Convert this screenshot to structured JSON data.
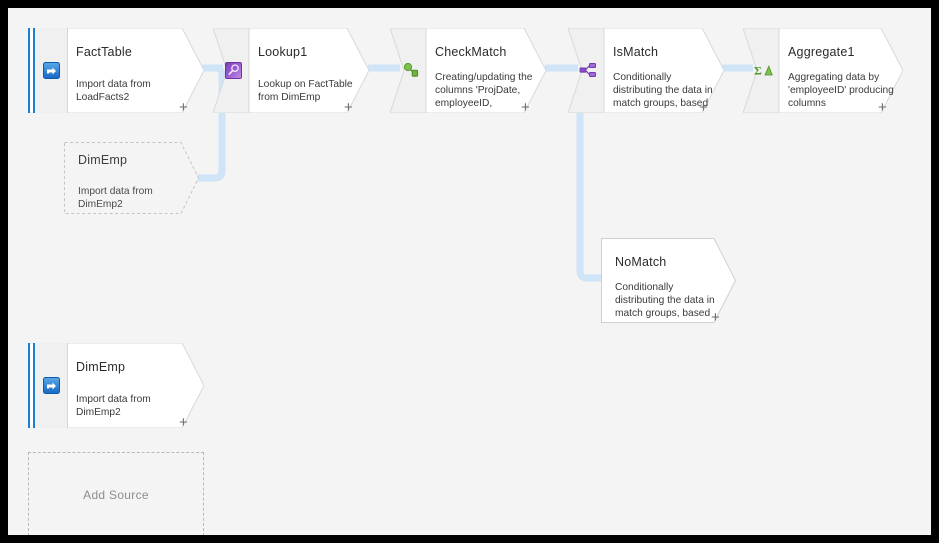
{
  "canvas": {
    "background_color": "#f4f4f4",
    "frame_color": "#000000",
    "connector_color": "#cfe5f7",
    "accent_color": "#1c7fd6"
  },
  "nodes": {
    "fact_table": {
      "title": "FactTable",
      "description": "Import data from LoadFacts2",
      "icon": "import-source-icon",
      "plus": "+",
      "kind": "source"
    },
    "lookup1": {
      "title": "Lookup1",
      "description": "Lookup on FactTable from DimEmp",
      "icon": "lookup-magnifier-icon",
      "plus": "+",
      "kind": "transform"
    },
    "check_match": {
      "title": "CheckMatch",
      "description": "Creating/updating the columns 'ProjDate, employeeID,",
      "icon": "derived-column-icon",
      "plus": "+",
      "kind": "transform"
    },
    "is_match": {
      "title": "IsMatch",
      "description": "Conditionally distributing the data in match groups, based",
      "icon": "conditional-split-icon",
      "plus": "+",
      "kind": "transform"
    },
    "aggregate1": {
      "title": "Aggregate1",
      "description": "Aggregating data by 'employeeID' producing columns",
      "icon": "aggregate-sigma-icon",
      "plus": "+",
      "kind": "transform"
    },
    "no_match": {
      "title": "NoMatch",
      "description": "Conditionally distributing the data in match groups, based",
      "icon": "none",
      "plus": "+",
      "kind": "branch"
    },
    "dim_emp_ghost": {
      "title": "DimEmp",
      "description": "Import data from DimEmp2",
      "icon": "none",
      "kind": "ghost"
    },
    "dim_emp_source": {
      "title": "DimEmp",
      "description": "Import data from DimEmp2",
      "icon": "import-source-icon",
      "plus": "+",
      "kind": "source"
    }
  },
  "add_source": {
    "label": "Add Source"
  }
}
